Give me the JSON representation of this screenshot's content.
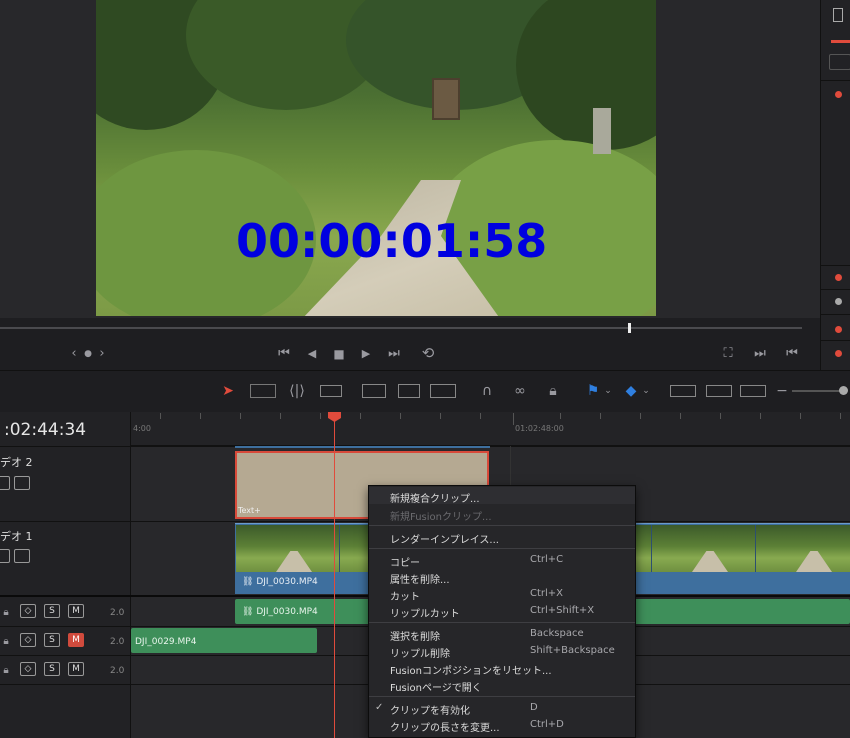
{
  "viewer": {
    "overlay_timecode": "00:00:01:58"
  },
  "transport": {
    "nav_prev": "‹",
    "nav_dot": "●",
    "nav_next": "›",
    "first_frame": "⏮",
    "reverse": "◀",
    "stop": "■",
    "play": "▶",
    "last_frame": "⏭",
    "loop": "⟲",
    "match_frame": "⛶",
    "next_edit": "⏭",
    "prev_edit": "⏮"
  },
  "timeline": {
    "timecode": ":02:44:34",
    "ruler_labels": [
      "4:00",
      "01:02:48:00"
    ],
    "tracks": {
      "video2": {
        "name": "デオ 2"
      },
      "video1": {
        "name": "デオ 1"
      },
      "audio_channels": [
        "2.0",
        "2.0",
        "2.0"
      ],
      "audio_buttons": {
        "s": "S",
        "m": "M"
      }
    },
    "clips": {
      "text_clip": "Text+",
      "video_clip": "DJI_0030.MP4",
      "audio_clip_1": "DJI_0030.MP4",
      "audio_clip_2": "DJI_0029.MP4"
    }
  },
  "context_menu": {
    "items": [
      {
        "label": "新規複合クリップ...",
        "shortcut": "",
        "disabled": false
      },
      {
        "label": "新規Fusionクリップ...",
        "shortcut": "",
        "disabled": true
      },
      {
        "label": "レンダーインプレイス...",
        "shortcut": "",
        "disabled": false
      },
      {
        "label": "コピー",
        "shortcut": "Ctrl+C",
        "disabled": false
      },
      {
        "label": "属性を削除...",
        "shortcut": "",
        "disabled": false
      },
      {
        "label": "カット",
        "shortcut": "Ctrl+X",
        "disabled": false
      },
      {
        "label": "リップルカット",
        "shortcut": "Ctrl+Shift+X",
        "disabled": false
      },
      {
        "label": "選択を削除",
        "shortcut": "Backspace",
        "disabled": false
      },
      {
        "label": "リップル削除",
        "shortcut": "Shift+Backspace",
        "disabled": false
      },
      {
        "label": "Fusionコンポジションをリセット...",
        "shortcut": "",
        "disabled": false
      },
      {
        "label": "Fusionページで開く",
        "shortcut": "",
        "disabled": false
      },
      {
        "label": "クリップを有効化",
        "shortcut": "D",
        "disabled": false,
        "checked": true
      },
      {
        "label": "クリップの長さを変更...",
        "shortcut": "Ctrl+D",
        "disabled": false
      }
    ],
    "check_mark": "✓"
  },
  "colors": {
    "playhead": "#e04b3c",
    "video_clip": "#3e6f9e",
    "audio_clip": "#3e8f5a",
    "text_clip": "#b5a992",
    "overlay_text": "#0000e0"
  }
}
